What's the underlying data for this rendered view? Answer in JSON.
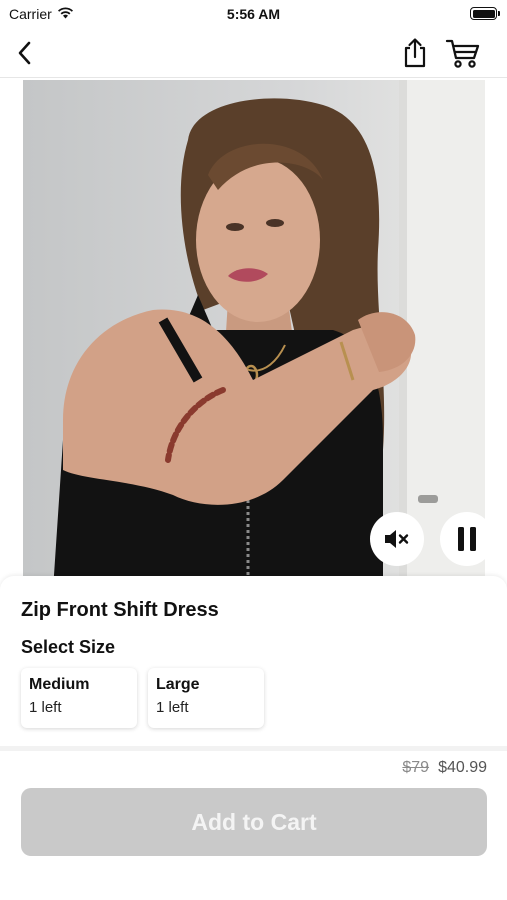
{
  "status_bar": {
    "carrier": "Carrier",
    "time": "5:56 AM",
    "wifi_icon": "wifi-icon",
    "battery_icon": "battery-icon"
  },
  "nav": {
    "back_icon": "chevron-left-icon",
    "share_icon": "share-icon",
    "cart_icon": "cart-icon"
  },
  "video": {
    "mute_icon": "speaker-muted-icon",
    "pause_icon": "pause-icon"
  },
  "product": {
    "title": "Zip Front Shift Dress",
    "size_label": "Select Size",
    "sizes": [
      {
        "name": "Medium",
        "stock": "1 left"
      },
      {
        "name": "Large",
        "stock": "1 left"
      }
    ],
    "original_price": "$79",
    "sale_price": "$40.99",
    "add_to_cart_label": "Add to Cart"
  },
  "colors": {
    "button_disabled": "#c9c9c9",
    "button_text": "#f4f4f4",
    "strike_price": "#8a8a8a"
  }
}
